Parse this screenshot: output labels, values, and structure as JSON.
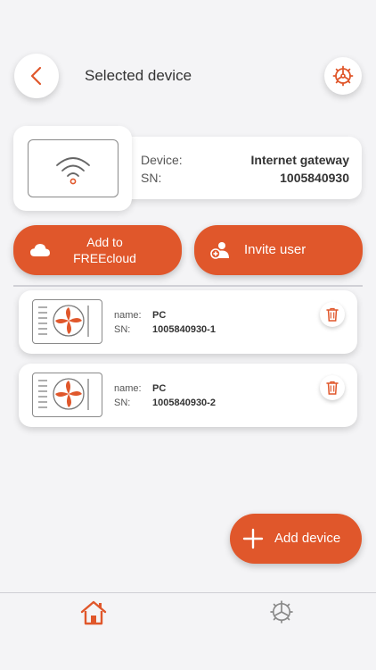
{
  "header": {
    "title": "Selected device",
    "back_icon": "chevron-left-icon",
    "settings_icon": "gear-icon"
  },
  "gateway": {
    "icon": "wifi-router-icon",
    "device_label": "Device:",
    "device_value": "Internet gateway",
    "sn_label": "SN:",
    "sn_value": "1005840930"
  },
  "actions": {
    "cloud_label_line1": "Add to",
    "cloud_label_line2": "FREEcloud",
    "cloud_icon": "cloud-icon",
    "invite_label": "Invite user",
    "invite_icon": "add-user-icon"
  },
  "devices": [
    {
      "name_label": "name:",
      "name": "PC",
      "sn_label": "SN:",
      "sn": "1005840930-1",
      "icon": "heat-pump-icon",
      "delete_icon": "trash-icon"
    },
    {
      "name_label": "name:",
      "name": "PC",
      "sn_label": "SN:",
      "sn": "1005840930-2",
      "icon": "heat-pump-icon",
      "delete_icon": "trash-icon"
    }
  ],
  "add_device": {
    "label": "Add device",
    "icon": "plus-icon"
  },
  "nav": {
    "home_icon": "home-icon",
    "settings_icon": "gear-icon",
    "active": "home"
  },
  "colors": {
    "accent": "#e0572b",
    "background": "#f4f4f6",
    "card": "#ffffff"
  }
}
